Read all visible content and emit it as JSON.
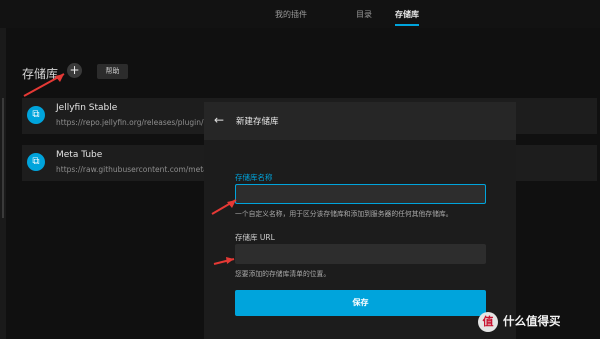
{
  "tabs": [
    "我的插件",
    "目录",
    "存储库"
  ],
  "page": {
    "title": "存储库",
    "add_symbol": "+",
    "help_label": "帮助"
  },
  "repositories": [
    {
      "name": "Jellyfin Stable",
      "url": "https://repo.jellyfin.org/releases/plugin/"
    },
    {
      "name": "Meta Tube",
      "url": "https://raw.githubusercontent.com/metatube"
    }
  ],
  "dialog": {
    "title": "新建存储库",
    "name_label": "存储库名称",
    "name_value": "",
    "name_help": "一个自定义名称，用于区分该存储库和添加到服务器的任何其他存储库。",
    "url_label": "存储库 URL",
    "url_value": "",
    "url_help": "您要添加的存储库清单的位置。",
    "save_label": "保存"
  },
  "watermark": {
    "badge": "值",
    "text": "什么值得买"
  },
  "colors": {
    "accent": "#00a4dc",
    "annotation": "#e53935"
  }
}
